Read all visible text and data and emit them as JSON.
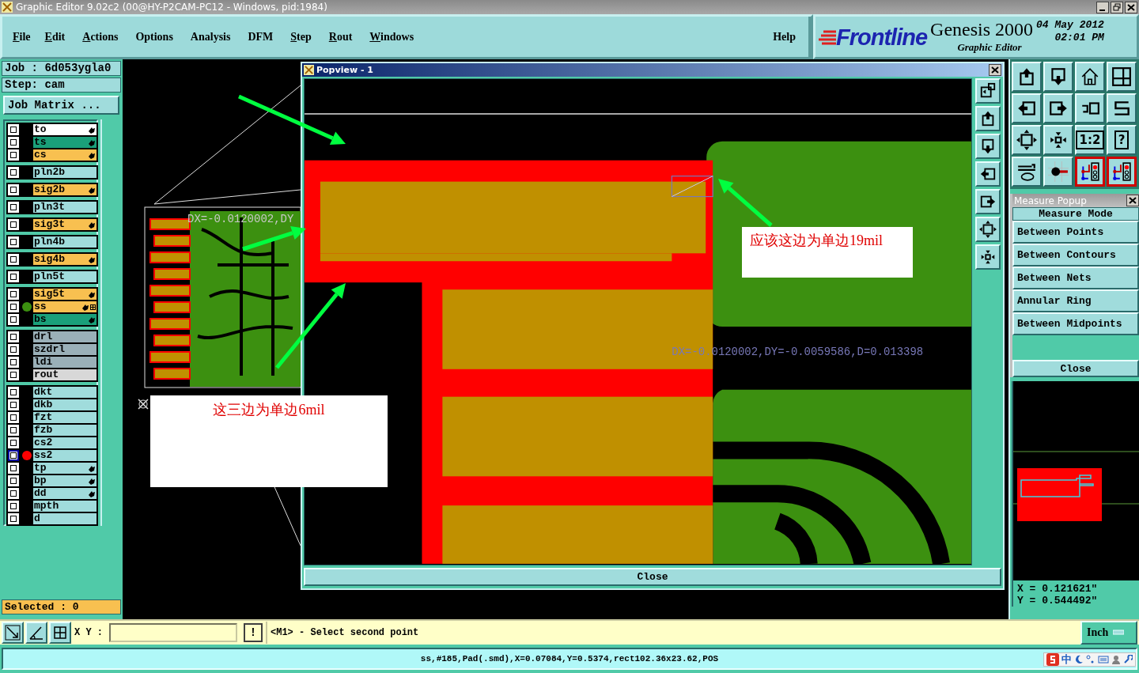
{
  "title_bar": {
    "title": "Graphic Editor 9.02c2 (00@HY-P2CAM-PC12 - Windows, pid:1984)"
  },
  "menu": [
    {
      "label": "File",
      "mnemonic": true
    },
    {
      "label": "Edit",
      "mnemonic": true
    },
    {
      "label": "Actions",
      "mnemonic": true
    },
    {
      "label": "Options",
      "mnemonic": false
    },
    {
      "label": "Analysis",
      "mnemonic": false
    },
    {
      "label": "DFM",
      "mnemonic": false
    },
    {
      "label": "Step",
      "mnemonic": true
    },
    {
      "label": "Rout",
      "mnemonic": true
    },
    {
      "label": "Windows",
      "mnemonic": true
    }
  ],
  "help": "Help",
  "brand": {
    "logo": "Frontline",
    "product": "Genesis 2000",
    "subtitle": "Graphic Editor",
    "date": "04 May 2012",
    "time": "02:01 PM"
  },
  "job": {
    "job": "Job : 6d053ygla0",
    "step": "Step: cam",
    "matrix_button": "Job Matrix ...",
    "selected": "Selected : 0"
  },
  "layer_groups": [
    [
      {
        "name": "to",
        "color": "#ffffff",
        "affected": true,
        "grid": false,
        "highlighted": false
      },
      {
        "name": "ts",
        "color": "#1aa07a",
        "affected": true,
        "grid": false,
        "highlighted": false
      },
      {
        "name": "cs",
        "color": "#f8c050",
        "affected": true,
        "grid": false,
        "highlighted": false
      }
    ],
    [
      {
        "name": "pln2b",
        "color": "#a0dcdc",
        "affected": false,
        "grid": false,
        "highlighted": false
      }
    ],
    [
      {
        "name": "sig2b",
        "color": "#f8c050",
        "affected": true,
        "grid": false,
        "highlighted": false
      }
    ],
    [
      {
        "name": "pln3t",
        "color": "#a0dcdc",
        "affected": false,
        "grid": false,
        "highlighted": false
      }
    ],
    [
      {
        "name": "sig3t",
        "color": "#f8c050",
        "affected": true,
        "grid": false,
        "highlighted": false
      }
    ],
    [
      {
        "name": "pln4b",
        "color": "#a0dcdc",
        "affected": false,
        "grid": false,
        "highlighted": false
      }
    ],
    [
      {
        "name": "sig4b",
        "color": "#f8c050",
        "affected": true,
        "grid": false,
        "highlighted": false
      }
    ],
    [
      {
        "name": "pln5t",
        "color": "#a0dcdc",
        "affected": false,
        "grid": false,
        "highlighted": false
      }
    ],
    [
      {
        "name": "sig5t",
        "color": "#f8c050",
        "affected": true,
        "grid": false,
        "highlighted": false
      },
      {
        "name": "ss",
        "color": "#f8c050",
        "affected": true,
        "grid": true,
        "highlighted": false,
        "marker": {
          "color": "#3c9010"
        }
      },
      {
        "name": "bs",
        "color": "#1aa07a",
        "affected": true,
        "grid": false,
        "highlighted": false
      }
    ],
    [
      {
        "name": "drl",
        "color": "#9ab0b8",
        "affected": false,
        "grid": false,
        "highlighted": false
      },
      {
        "name": "szdrl",
        "color": "#9ab0b8",
        "affected": false,
        "grid": false,
        "highlighted": false
      },
      {
        "name": "ldi",
        "color": "#9ab0b8",
        "affected": false,
        "grid": false,
        "highlighted": false
      },
      {
        "name": "rout",
        "color": "#d8d8d8",
        "affected": false,
        "grid": false,
        "highlighted": false
      }
    ],
    [
      {
        "name": "dkt",
        "color": "#a0dcdc",
        "affected": false,
        "grid": false,
        "highlighted": false
      },
      {
        "name": "dkb",
        "color": "#a0dcdc",
        "affected": false,
        "grid": false,
        "highlighted": false
      },
      {
        "name": "fzt",
        "color": "#a0dcdc",
        "affected": false,
        "grid": false,
        "highlighted": false
      },
      {
        "name": "fzb",
        "color": "#a0dcdc",
        "affected": false,
        "grid": false,
        "highlighted": false
      },
      {
        "name": "cs2",
        "color": "#a0dcdc",
        "affected": false,
        "grid": false,
        "highlighted": false
      },
      {
        "name": "ss2",
        "color": "#a0dcdc",
        "affected": false,
        "grid": false,
        "highlighted": true,
        "marker": {
          "color": "#ff0000"
        }
      },
      {
        "name": "tp",
        "color": "#a0dcdc",
        "affected": true,
        "grid": false,
        "highlighted": false
      },
      {
        "name": "bp",
        "color": "#a0dcdc",
        "affected": true,
        "grid": false,
        "highlighted": false
      },
      {
        "name": "dd",
        "color": "#a0dcdc",
        "affected": true,
        "grid": false,
        "highlighted": false
      },
      {
        "name": "mpth",
        "color": "#a0dcdc",
        "affected": false,
        "grid": false,
        "highlighted": false
      },
      {
        "name": "d",
        "color": "#a0dcdc",
        "affected": false,
        "grid": false,
        "highlighted": false
      }
    ]
  ],
  "canvas": {
    "measure_text": "DX=-0.0120002,DY"
  },
  "popview": {
    "title": "Popview - 1",
    "measure_text": "DX=-0.0120002,DY=-0.0059586,D=0.013398",
    "close": "Close",
    "tools": [
      {
        "kind": "window-back"
      },
      {
        "kind": "box-up"
      },
      {
        "kind": "box-down"
      },
      {
        "kind": "box-left"
      },
      {
        "kind": "box-right"
      },
      {
        "kind": "expand"
      },
      {
        "kind": "contract"
      }
    ]
  },
  "notes": [
    {
      "text": "这三边为单边6mil"
    },
    {
      "text": "应该这边为单边19mil"
    }
  ],
  "tools": [
    {
      "kind": "box-up",
      "active": false
    },
    {
      "kind": "box-down",
      "active": false
    },
    {
      "kind": "house",
      "active": false
    },
    {
      "kind": "window-grid",
      "active": false
    },
    {
      "kind": "box-left",
      "active": false
    },
    {
      "kind": "box-right",
      "active": false
    },
    {
      "kind": "undo-box",
      "active": false
    },
    {
      "kind": "s-curve",
      "active": false
    },
    {
      "kind": "expand",
      "active": false
    },
    {
      "kind": "contract",
      "active": false
    },
    {
      "kind": "label",
      "label": "1:2",
      "active": false
    },
    {
      "kind": "label",
      "label": "?",
      "active": false
    },
    {
      "kind": "pen-palette",
      "active": false
    },
    {
      "kind": "probe",
      "active": false
    },
    {
      "kind": "net",
      "active": true
    },
    {
      "kind": "net",
      "active": true
    }
  ],
  "measure_popup": {
    "title": "Measure Popup",
    "heading": "Measure Mode",
    "modes": [
      "Between Points",
      "Between Contours",
      "Between Nets",
      "Annular Ring",
      "Between Midpoints"
    ],
    "close": "Close"
  },
  "coords": {
    "x": "X = 0.121621\"",
    "y": "Y = 0.544492\""
  },
  "command_bar": {
    "xy_label": "X Y :",
    "alert_button": "!",
    "message": "<M1> - Select second point",
    "units": "Inch"
  },
  "status": "ss,#185,Pad(.smd),X=0.07084,Y=0.5374,rect102.36x23.62,POS",
  "tray": {
    "ime": "中"
  }
}
